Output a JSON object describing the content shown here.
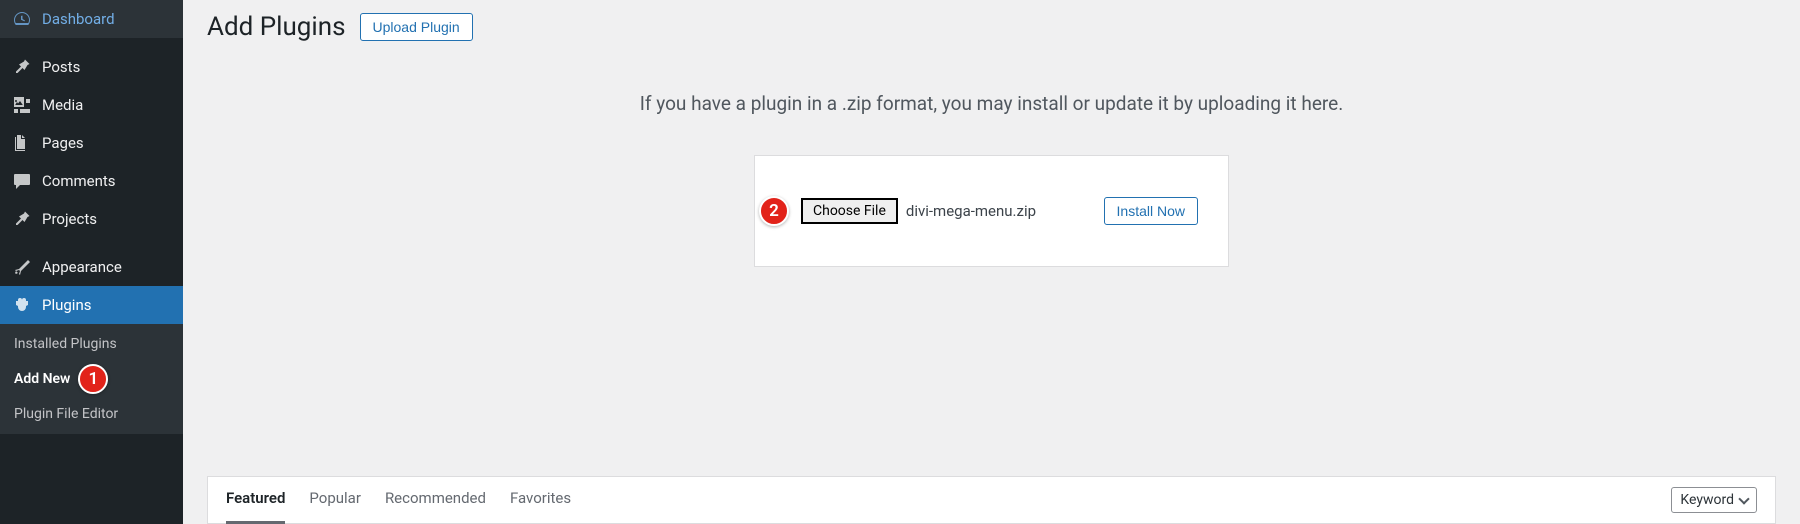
{
  "sidebar": {
    "items": [
      {
        "label": "Dashboard"
      },
      {
        "label": "Posts"
      },
      {
        "label": "Media"
      },
      {
        "label": "Pages"
      },
      {
        "label": "Comments"
      },
      {
        "label": "Projects"
      },
      {
        "label": "Appearance"
      },
      {
        "label": "Plugins"
      }
    ],
    "sub": [
      {
        "label": "Installed Plugins"
      },
      {
        "label": "Add New"
      },
      {
        "label": "Plugin File Editor"
      }
    ]
  },
  "header": {
    "title": "Add Plugins",
    "upload_button": "Upload Plugin"
  },
  "upload": {
    "description": "If you have a plugin in a .zip format, you may install or update it by uploading it here.",
    "choose_file_label": "Choose File",
    "filename": "divi-mega-menu.zip",
    "install_label": "Install Now"
  },
  "tabs": [
    "Featured",
    "Popular",
    "Recommended",
    "Favorites"
  ],
  "search": {
    "keyword_label": "Keyword"
  },
  "annotations": {
    "badge1": "1",
    "badge2": "2"
  }
}
